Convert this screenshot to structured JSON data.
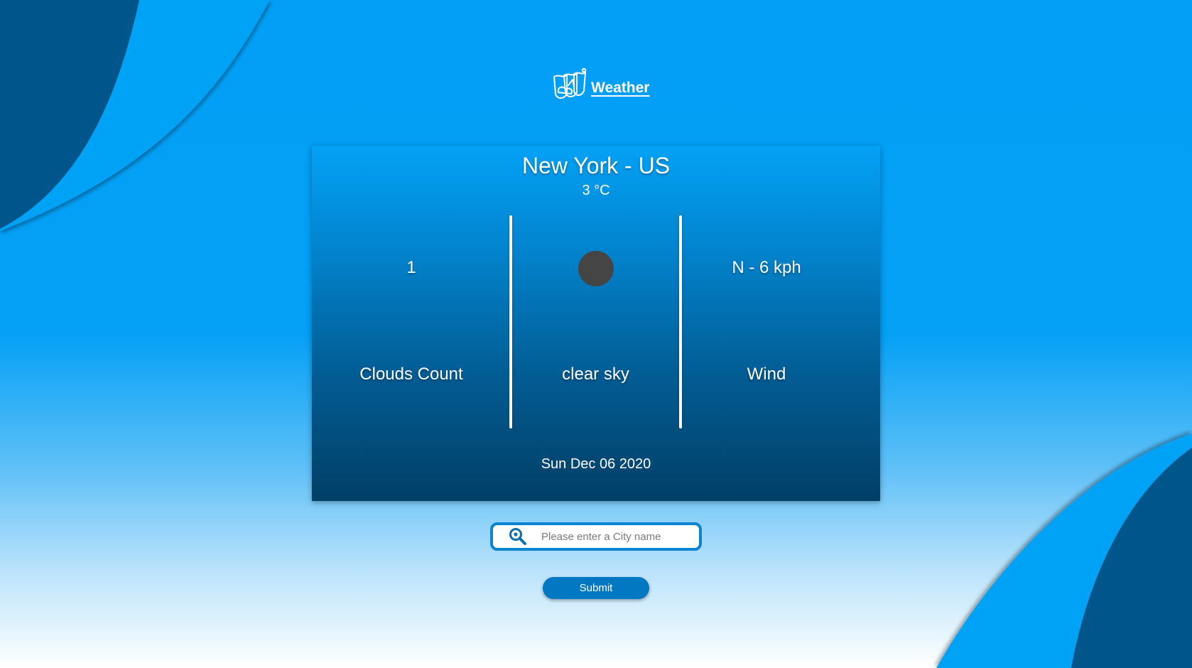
{
  "brand": {
    "name": "Weather",
    "logo_icon": "weather-logo-icon"
  },
  "card": {
    "city": "New York - US",
    "temperature": "3 °C",
    "clouds": {
      "value": "1",
      "label": "Clouds Count"
    },
    "condition": {
      "icon": "weather-condition-icon",
      "label": "clear sky"
    },
    "wind": {
      "value": "N - 6 kph",
      "label": "Wind"
    },
    "date": "Sun Dec 06 2020"
  },
  "search": {
    "icon": "search-icon",
    "placeholder": "Please enter a City name",
    "value": ""
  },
  "submit": {
    "label": "Submit"
  },
  "colors": {
    "background_top": "#039ff6",
    "accent_dark": "#005a90",
    "card_top": "#03a2f6",
    "card_bottom": "#013f66",
    "button": "#0277c2",
    "search_border": "#0a84d0"
  }
}
